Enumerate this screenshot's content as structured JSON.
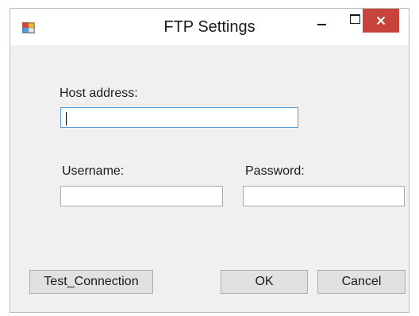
{
  "window": {
    "title": "FTP Settings",
    "icon": "app-window-icon",
    "controls": {
      "minimize_icon": "minimize-icon",
      "maximize_icon": "maximize-icon",
      "close_icon": "close-icon",
      "close_glyph": "✕",
      "close_color": "#c7443d"
    }
  },
  "form": {
    "host": {
      "label": "Host address:",
      "value": "",
      "focused": true
    },
    "username": {
      "label": "Username:",
      "value": ""
    },
    "password": {
      "label": "Password:",
      "value": ""
    }
  },
  "buttons": {
    "test_connection": "Test_Connection",
    "ok": "OK",
    "cancel": "Cancel"
  },
  "colors": {
    "window_bg": "#f0f0f0",
    "focus_border": "#5d9ad8",
    "button_bg": "#e1e1e1"
  }
}
